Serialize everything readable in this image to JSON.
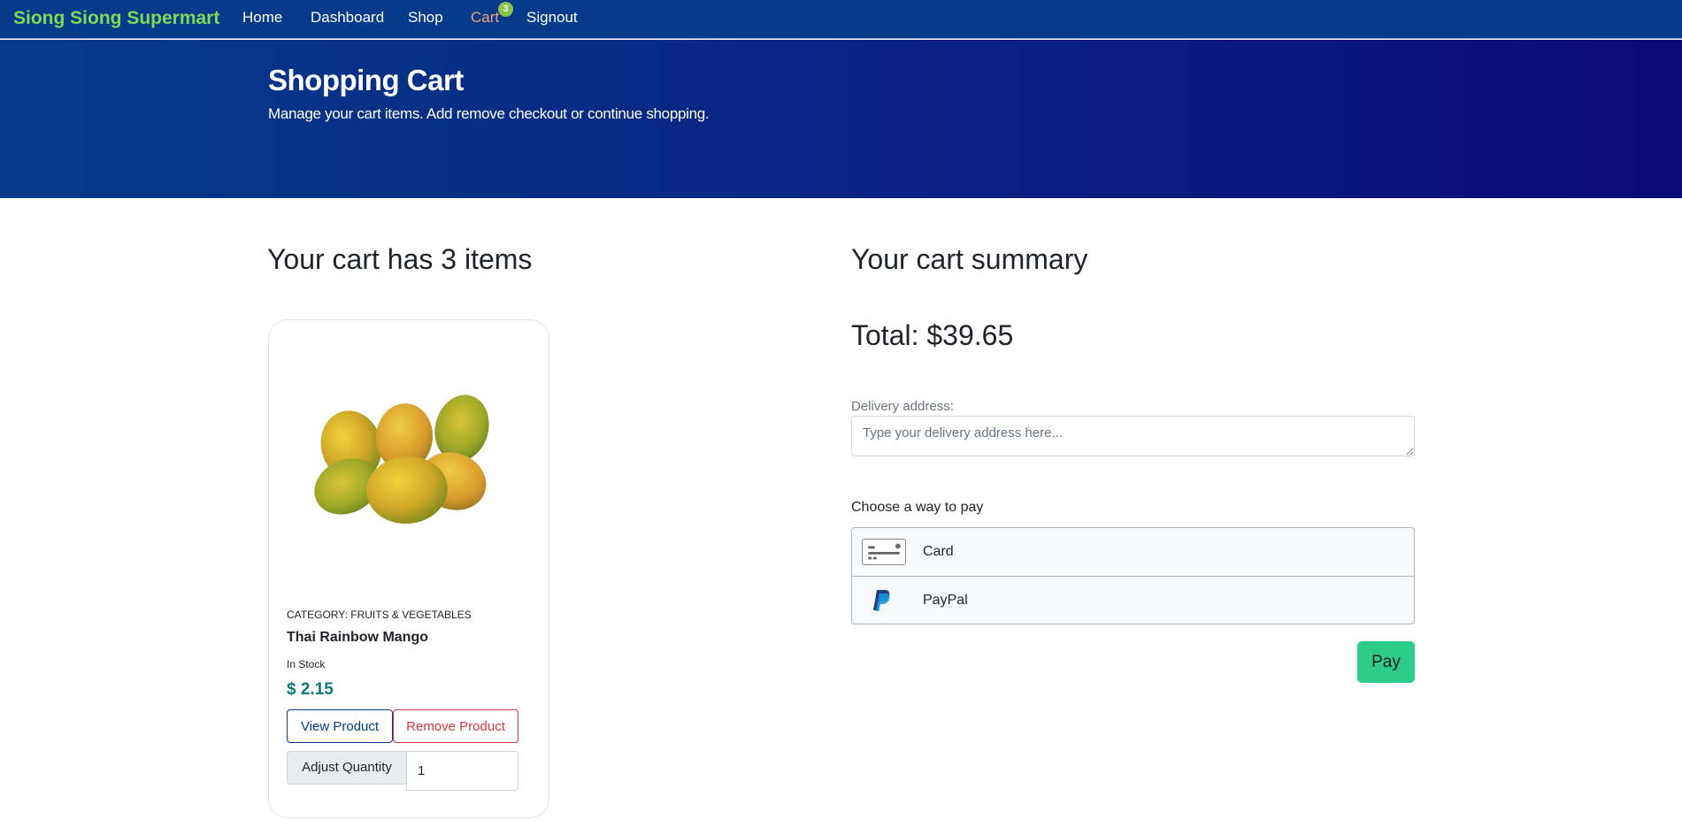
{
  "nav": {
    "brand": "Siong Siong Supermart",
    "links": [
      "Home",
      "Dashboard",
      "Shop",
      "Cart",
      "Signout"
    ],
    "cart_count": "3",
    "active_link_color": "#f5a37c"
  },
  "hero": {
    "title": "Shopping Cart",
    "subtitle": "Manage your cart items. Add remove checkout or continue shopping."
  },
  "cart": {
    "heading": "Your cart has 3 items",
    "items": [
      {
        "category": "CATEGORY: FRUITS & VEGETABLES",
        "name": "Thai Rainbow Mango",
        "stock": "In Stock",
        "price": "$ 2.15",
        "view_label": "View Product",
        "remove_label": "Remove Product",
        "qty_label": "Adjust Quantity",
        "qty_value": "1",
        "image_icon": "mango-image"
      }
    ]
  },
  "summary": {
    "heading": "Your cart summary",
    "total": "Total: $39.65",
    "address_label": "Delivery address:",
    "address_placeholder": "Type your delivery address here...",
    "pay_label": "Choose a way to pay",
    "pay_options": [
      {
        "label": "Card",
        "icon": "credit-card-icon"
      },
      {
        "label": "PayPal",
        "icon": "paypal-icon"
      }
    ],
    "pay_button": "Pay"
  },
  "colors": {
    "nav_bg": "#053b8a",
    "brand": "#7ed957",
    "price": "#0f7a7a",
    "pay_button": "#2ecc8b",
    "remove": "#dc3545"
  }
}
